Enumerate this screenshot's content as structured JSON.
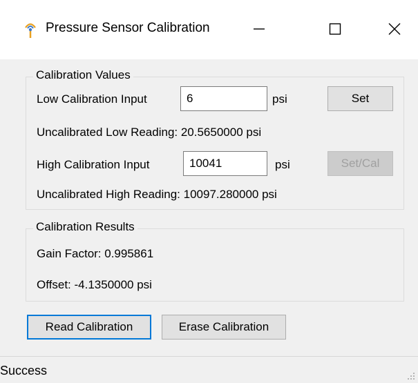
{
  "window": {
    "title": "Pressure Sensor Calibration",
    "accent_color": "#0078d7"
  },
  "calibration_values": {
    "group_label": "Calibration Values",
    "low_input_label": "Low Calibration Input",
    "low_input_value": "6",
    "low_unit": "psi",
    "set_button": "Set",
    "uncal_low_text": "Uncalibrated Low Reading: 20.5650000 psi",
    "high_input_label": "High Calibration Input",
    "high_input_value": "10041",
    "high_unit": "psi",
    "setcal_button": "Set/Cal",
    "uncal_high_text": "Uncalibrated High Reading: 10097.280000 psi"
  },
  "calibration_results": {
    "group_label": "Calibration Results",
    "gain_text": "Gain Factor: 0.995861",
    "offset_text": "Offset: -4.1350000 psi"
  },
  "actions": {
    "read_button": "Read Calibration",
    "erase_button": "Erase Calibration"
  },
  "status": {
    "text": "Success"
  }
}
